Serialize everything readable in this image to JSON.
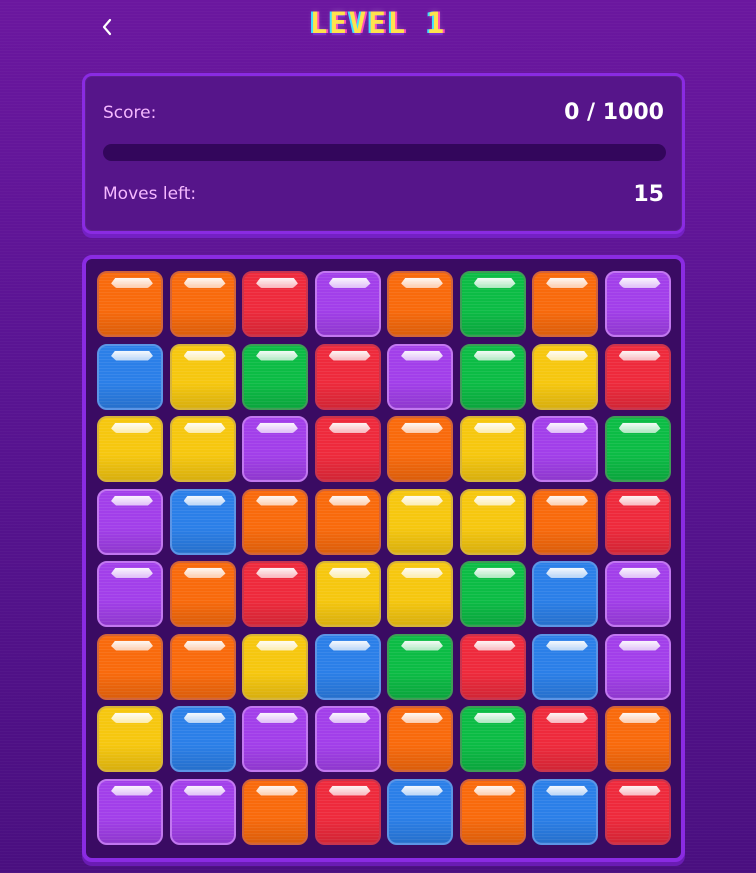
{
  "header": {
    "title": "LEVEL 1",
    "back_icon": "chevron-left-icon"
  },
  "stats": {
    "score_label": "Score:",
    "score_value": "0 / 1000",
    "score_progress": 0,
    "moves_label": "Moves left:",
    "moves_value": "15"
  },
  "colors": {
    "orange": {
      "fill": "#f96a0c",
      "border": "#d2643a"
    },
    "red": {
      "fill": "#ee2a3c",
      "border": "#c9344e"
    },
    "purple": {
      "fill": "#a23fea",
      "border": "#c277f0"
    },
    "green": {
      "fill": "#0cbc45",
      "border": "#3e9d56"
    },
    "blue": {
      "fill": "#2b7fe8",
      "border": "#5b95e6"
    },
    "yellow": {
      "fill": "#f6c70f",
      "border": "#d7b43a"
    }
  },
  "board": {
    "rows": [
      [
        "orange",
        "orange",
        "red",
        "purple",
        "orange",
        "green",
        "orange",
        "purple"
      ],
      [
        "blue",
        "yellow",
        "green",
        "red",
        "purple",
        "green",
        "yellow",
        "red"
      ],
      [
        "yellow",
        "yellow",
        "purple",
        "red",
        "orange",
        "yellow",
        "purple",
        "green"
      ],
      [
        "purple",
        "blue",
        "orange",
        "orange",
        "yellow",
        "yellow",
        "orange",
        "red"
      ],
      [
        "purple",
        "orange",
        "red",
        "yellow",
        "yellow",
        "green",
        "blue",
        "purple"
      ],
      [
        "orange",
        "orange",
        "yellow",
        "blue",
        "green",
        "red",
        "blue",
        "purple"
      ],
      [
        "yellow",
        "blue",
        "purple",
        "purple",
        "orange",
        "green",
        "red",
        "orange"
      ],
      [
        "purple",
        "purple",
        "orange",
        "red",
        "blue",
        "orange",
        "blue",
        "red"
      ]
    ]
  }
}
